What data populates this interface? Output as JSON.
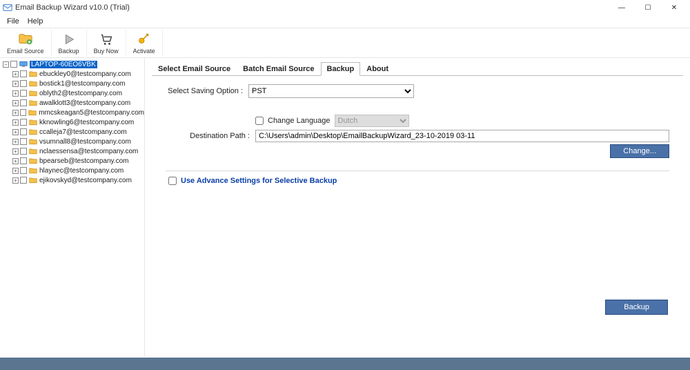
{
  "window": {
    "title": "Email Backup Wizard v10.0 (Trial)",
    "minimize": "—",
    "maximize": "☐",
    "close": "✕"
  },
  "menu": {
    "file": "File",
    "help": "Help"
  },
  "toolbar": {
    "email_source": "Email Source",
    "backup": "Backup",
    "buy_now": "Buy Now",
    "activate": "Activate"
  },
  "sidebar": {
    "root": "LAPTOP-60EO6VBK",
    "items": [
      "ebuckley0@testcompany.com",
      "bostick1@testcompany.com",
      "oblyth2@testcompany.com",
      "awalklott3@testcompany.com",
      "mmcskeagan5@testcompany.com",
      "kknowling6@testcompany.com",
      "ccalleja7@testcompany.com",
      "vsumnall8@testcompany.com",
      "nclaessensa@testcompany.com",
      "bpearseb@testcompany.com",
      "hlaynec@testcompany.com",
      "ejikovskyd@testcompany.com"
    ]
  },
  "tabs": {
    "select_source": "Select Email Source",
    "batch_source": "Batch Email Source",
    "backup": "Backup",
    "about": "About"
  },
  "form": {
    "saving_label": "Select Saving Option :",
    "saving_value": "PST",
    "change_language_label": "Change Language",
    "language_value": "Dutch",
    "dest_label": "Destination Path :",
    "dest_value": "C:\\Users\\admin\\Desktop\\EmailBackupWizard_23-10-2019 03-11",
    "change_btn": "Change...",
    "advance_label": "Use Advance Settings for Selective Backup",
    "backup_btn": "Backup"
  }
}
